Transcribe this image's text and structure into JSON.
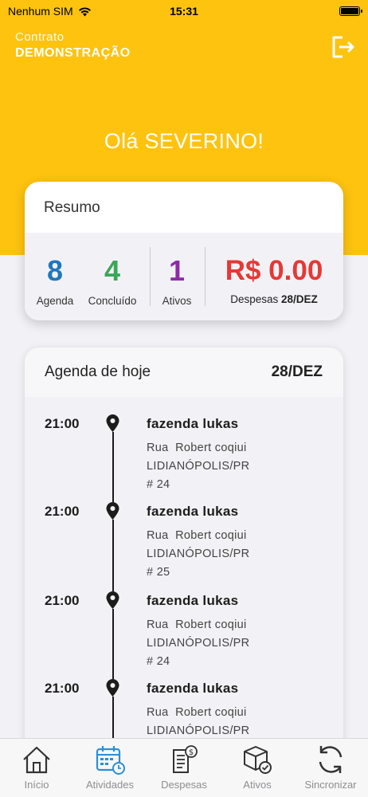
{
  "status_bar": {
    "carrier": "Nenhum SIM",
    "time": "15:31"
  },
  "header": {
    "contract_label": "Contrato",
    "contract_name": "DEMONSTRAÇÃO",
    "greeting": "Olá SEVERINO!"
  },
  "summary": {
    "title": "Resumo",
    "stats": [
      {
        "value": "8",
        "label": "Agenda",
        "color": "#1f77bf"
      },
      {
        "value": "4",
        "label": "Concluído",
        "color": "#3aa757"
      },
      {
        "value": "1",
        "label": "Ativos",
        "color": "#8e2aa8"
      }
    ],
    "expenses": {
      "value": "R$ 0.00",
      "label": "Despesas",
      "date": "28/DEZ",
      "color": "#e53935"
    }
  },
  "agenda": {
    "title": "Agenda de hoje",
    "date": "28/DEZ",
    "items": [
      {
        "time": "21:00",
        "title": "fazenda lukas",
        "address": "Rua  Robert coqiui",
        "city": "LIDIANÓPOLIS/PR",
        "number": "# 24"
      },
      {
        "time": "21:00",
        "title": "fazenda lukas",
        "address": "Rua  Robert coqiui",
        "city": "LIDIANÓPOLIS/PR",
        "number": "# 25"
      },
      {
        "time": "21:00",
        "title": "fazenda lukas",
        "address": "Rua  Robert coqiui",
        "city": "LIDIANÓPOLIS/PR",
        "number": "# 24"
      },
      {
        "time": "21:00",
        "title": "fazenda lukas",
        "address": "Rua  Robert coqiui",
        "city": "LIDIANÓPOLIS/PR",
        "number": ""
      }
    ]
  },
  "tabs": [
    {
      "label": "Início",
      "icon": "home-icon",
      "active": true
    },
    {
      "label": "Atividades",
      "icon": "calendar-icon",
      "active": false
    },
    {
      "label": "Despesas",
      "icon": "receipt-icon",
      "active": false
    },
    {
      "label": "Ativos",
      "icon": "box-icon",
      "active": false
    },
    {
      "label": "Sincronizar",
      "icon": "sync-icon",
      "active": false
    }
  ],
  "colors": {
    "brand": "#fdc30f",
    "tab_active_accent": "#2d8fd5"
  }
}
